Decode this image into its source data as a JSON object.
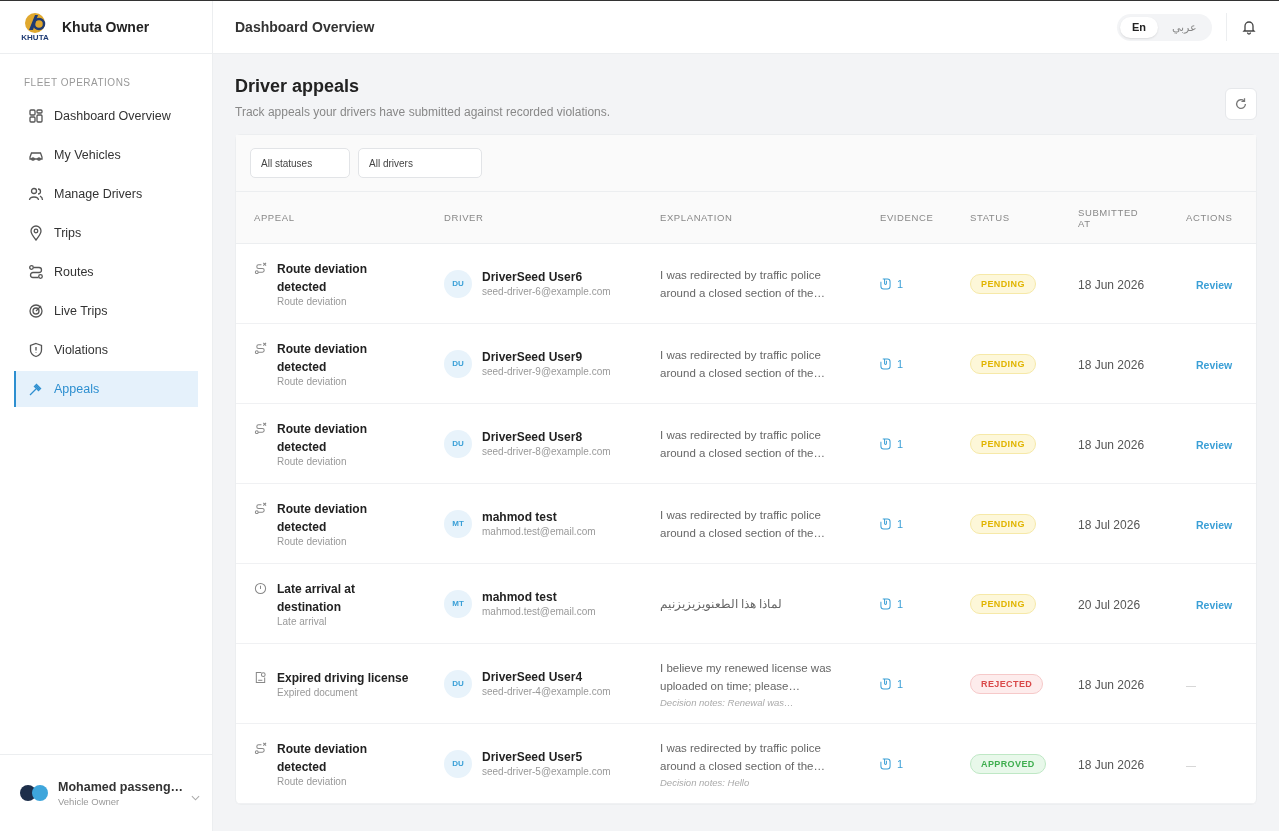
{
  "brand": {
    "logo_text": "KHUTA",
    "name": "Khuta Owner"
  },
  "topbar": {
    "title": "Dashboard Overview",
    "languages": [
      {
        "label": "En",
        "selected": true
      },
      {
        "label": "عربي",
        "selected": false
      }
    ]
  },
  "sidebar": {
    "section": "FLEET OPERATIONS",
    "items": [
      {
        "label": "Dashboard Overview",
        "kind": "grid",
        "selected": false
      },
      {
        "label": "My Vehicles",
        "kind": "car",
        "selected": false
      },
      {
        "label": "Manage Drivers",
        "kind": "users",
        "selected": false
      },
      {
        "label": "Trips",
        "kind": "pin",
        "selected": false
      },
      {
        "label": "Routes",
        "kind": "route",
        "selected": false
      },
      {
        "label": "Live Trips",
        "kind": "radar",
        "selected": false
      },
      {
        "label": "Violations",
        "kind": "shield",
        "selected": false
      },
      {
        "label": "Appeals",
        "kind": "gavel",
        "selected": true
      }
    ],
    "user": {
      "name": "Mohamed passeng…",
      "role": "Vehicle Owner"
    }
  },
  "page": {
    "title": "Driver appeals",
    "subtitle": "Track appeals your drivers have submitted against recorded violations."
  },
  "filters": [
    {
      "value": "All statuses"
    },
    {
      "value": "All drivers"
    }
  ],
  "table": {
    "columns": [
      "APPEAL",
      "DRIVER",
      "EXPLANATION",
      "EVIDENCE",
      "STATUS",
      "SUBMITTED AT",
      "ACTIONS"
    ],
    "rows": [
      {
        "kind": "route",
        "title": "Route deviation detected",
        "type": "Route deviation",
        "initials": "DU",
        "driver": "DriverSeed User6",
        "email": "seed-driver-6@example.com",
        "explanation": "I was redirected by traffic police around a closed section of the…",
        "evidence": "1",
        "status": {
          "text": "PENDING",
          "kind": "pending"
        },
        "action": {
          "text": "Review",
          "kind": "link"
        },
        "date": "18 Jun 2026"
      },
      {
        "kind": "route",
        "title": "Route deviation detected",
        "type": "Route deviation",
        "initials": "DU",
        "driver": "DriverSeed User9",
        "email": "seed-driver-9@example.com",
        "explanation": "I was redirected by traffic police around a closed section of the…",
        "evidence": "1",
        "status": {
          "text": "PENDING",
          "kind": "pending"
        },
        "action": {
          "text": "Review",
          "kind": "link"
        },
        "date": "18 Jun 2026"
      },
      {
        "kind": "route",
        "title": "Route deviation detected",
        "type": "Route deviation",
        "initials": "DU",
        "driver": "DriverSeed User8",
        "email": "seed-driver-8@example.com",
        "explanation": "I was redirected by traffic police around a closed section of the…",
        "evidence": "1",
        "status": {
          "text": "PENDING",
          "kind": "pending"
        },
        "action": {
          "text": "Review",
          "kind": "link"
        },
        "date": "18 Jun 2026"
      },
      {
        "kind": "route",
        "title": "Route deviation detected",
        "type": "Route deviation",
        "initials": "MT",
        "driver": "mahmod test",
        "email": "mahmod.test@email.com",
        "explanation": "I was redirected by traffic police around a closed section of the…",
        "evidence": "1",
        "status": {
          "text": "PENDING",
          "kind": "pending"
        },
        "action": {
          "text": "Review",
          "kind": "link"
        },
        "date": "18 Jul 2026"
      },
      {
        "kind": "clock",
        "title": "Late arrival at destination",
        "type": "Late arrival",
        "initials": "MT",
        "driver": "mahmod test",
        "email": "mahmod.test@email.com",
        "explanation": "لماذا هذا الطعنويزيزيزنيم",
        "evidence": "1",
        "status": {
          "text": "PENDING",
          "kind": "pending"
        },
        "action": {
          "text": "Review",
          "kind": "link"
        },
        "date": "20 Jul 2026"
      },
      {
        "kind": "document",
        "title": "Expired driving license",
        "type": "Expired document",
        "initials": "DU",
        "driver": "DriverSeed User4",
        "email": "seed-driver-4@example.com",
        "explanation": "I believe my renewed license was uploaded on time; please…",
        "notes": "Decision notes: Renewal was…",
        "evidence": "1",
        "status": {
          "text": "REJECTED",
          "kind": "rejected"
        },
        "action": {
          "text": "—",
          "kind": "none"
        },
        "date": "18 Jun 2026"
      },
      {
        "kind": "route",
        "title": "Route deviation detected",
        "type": "Route deviation",
        "initials": "DU",
        "driver": "DriverSeed User5",
        "email": "seed-driver-5@example.com",
        "explanation": "I was redirected by traffic police around a closed section of the…",
        "notes": "Decision notes: Hello",
        "evidence": "1",
        "status": {
          "text": "APPROVED",
          "kind": "approved"
        },
        "action": {
          "text": "—",
          "kind": "none"
        },
        "date": "18 Jun 2026"
      }
    ]
  }
}
